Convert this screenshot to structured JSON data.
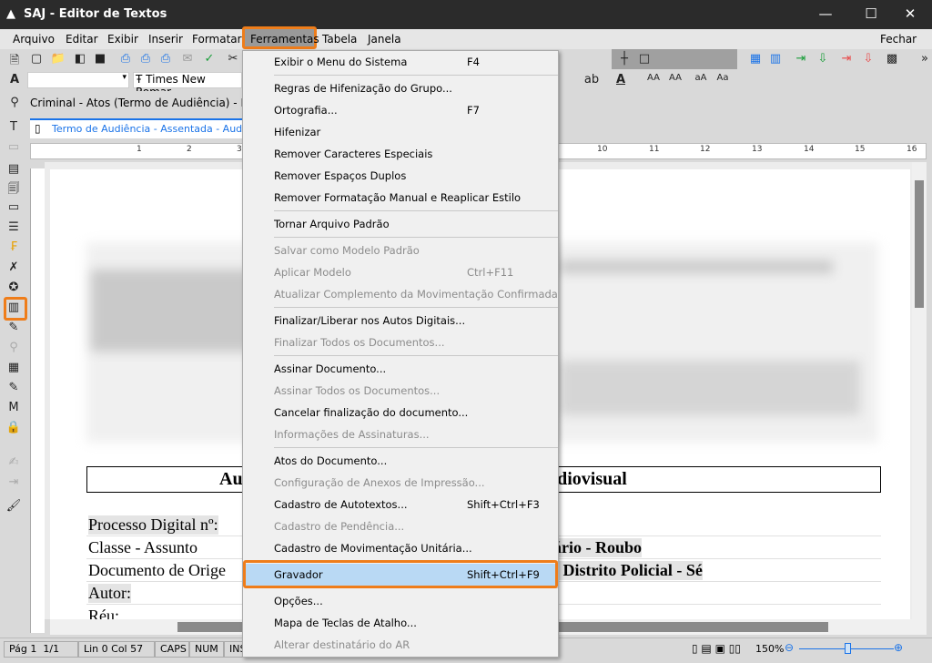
{
  "window": {
    "title": "SAJ - Editor de Textos",
    "minimize": "—",
    "maximize": "☐",
    "close": "✕"
  },
  "menubar": {
    "items": [
      "Arquivo",
      "Editar",
      "Exibir",
      "Inserir",
      "Formatar",
      "Ferramentas",
      "Tabela",
      "Janela"
    ],
    "close_label": "Fechar"
  },
  "toolbar": {
    "font_name": "Times New Romar",
    "style_value": ""
  },
  "breadcrumb": "Criminal - Atos (Termo de Audiência) - Fila:",
  "doc_tab": "Termo de Audiência - Assentada - Audiov",
  "ruler_numbers": [
    "1",
    "2",
    "3",
    "10",
    "11",
    "12",
    "13",
    "14",
    "15",
    "16"
  ],
  "document": {
    "title_left": "Au",
    "title_right": "udiovisual",
    "rows": [
      {
        "label": "Processo Digital nº:",
        "value": ""
      },
      {
        "label": "Classe - Assunto",
        "value": "ário - Roubo"
      },
      {
        "label": "Documento de Orige",
        "value": "º Distrito Policial - Sé"
      },
      {
        "label": "Autor:",
        "value": ""
      },
      {
        "label": "Réu:",
        "value": ""
      }
    ]
  },
  "menu": {
    "items": [
      {
        "label": "Exibir o Menu do Sistema",
        "shortcut": "F4"
      },
      {
        "sep": true
      },
      {
        "label": "Regras de Hifenização do Grupo..."
      },
      {
        "label": "Ortografia...",
        "shortcut": "F7"
      },
      {
        "label": "Hifenizar"
      },
      {
        "label": "Remover Caracteres Especiais"
      },
      {
        "label": "Remover Espaços Duplos"
      },
      {
        "label": "Remover Formatação Manual e Reaplicar Estilo"
      },
      {
        "sep": true
      },
      {
        "label": "Tornar Arquivo Padrão"
      },
      {
        "sep": true
      },
      {
        "label": "Salvar como Modelo Padrão",
        "disabled": true
      },
      {
        "label": "Aplicar Modelo",
        "shortcut": "Ctrl+F11",
        "disabled": true
      },
      {
        "label": "Atualizar Complemento da Movimentação Confirmada",
        "disabled": true
      },
      {
        "sep": true
      },
      {
        "label": "Finalizar/Liberar nos Autos Digitais..."
      },
      {
        "label": "Finalizar Todos os Documentos...",
        "disabled": true
      },
      {
        "sep": true
      },
      {
        "label": "Assinar Documento..."
      },
      {
        "label": "Assinar Todos os Documentos...",
        "disabled": true
      },
      {
        "label": "Cancelar finalização do documento..."
      },
      {
        "label": "Informações de Assinaturas...",
        "disabled": true
      },
      {
        "sep": true
      },
      {
        "label": "Atos do Documento..."
      },
      {
        "label": "Configuração de Anexos de Impressão...",
        "disabled": true
      },
      {
        "label": "Cadastro de Autotextos...",
        "shortcut": "Shift+Ctrl+F3"
      },
      {
        "label": "Cadastro de Pendência...",
        "disabled": true
      },
      {
        "label": "Cadastro de Movimentação Unitária..."
      },
      {
        "sep": true
      },
      {
        "label": "Gravador",
        "shortcut": "Shift+Ctrl+F9",
        "highlighted": true
      },
      {
        "sep": true
      },
      {
        "label": "Opções..."
      },
      {
        "label": "Mapa de Teclas de Atalho..."
      },
      {
        "label": "Alterar destinatário do AR",
        "disabled": true
      }
    ]
  },
  "annotation_badge": "1",
  "statusbar": {
    "page": "Pág 1",
    "pages": "1/1",
    "position": "Lin 0  Col 57",
    "caps": "CAPS",
    "num": "NUM",
    "ins": "INS",
    "zoom": "150%",
    "zoom_level_percent": 150
  },
  "colors": {
    "highlight": "#ef7d1a",
    "menu_selection": "#b9d9f4",
    "link": "#1a73e8"
  }
}
